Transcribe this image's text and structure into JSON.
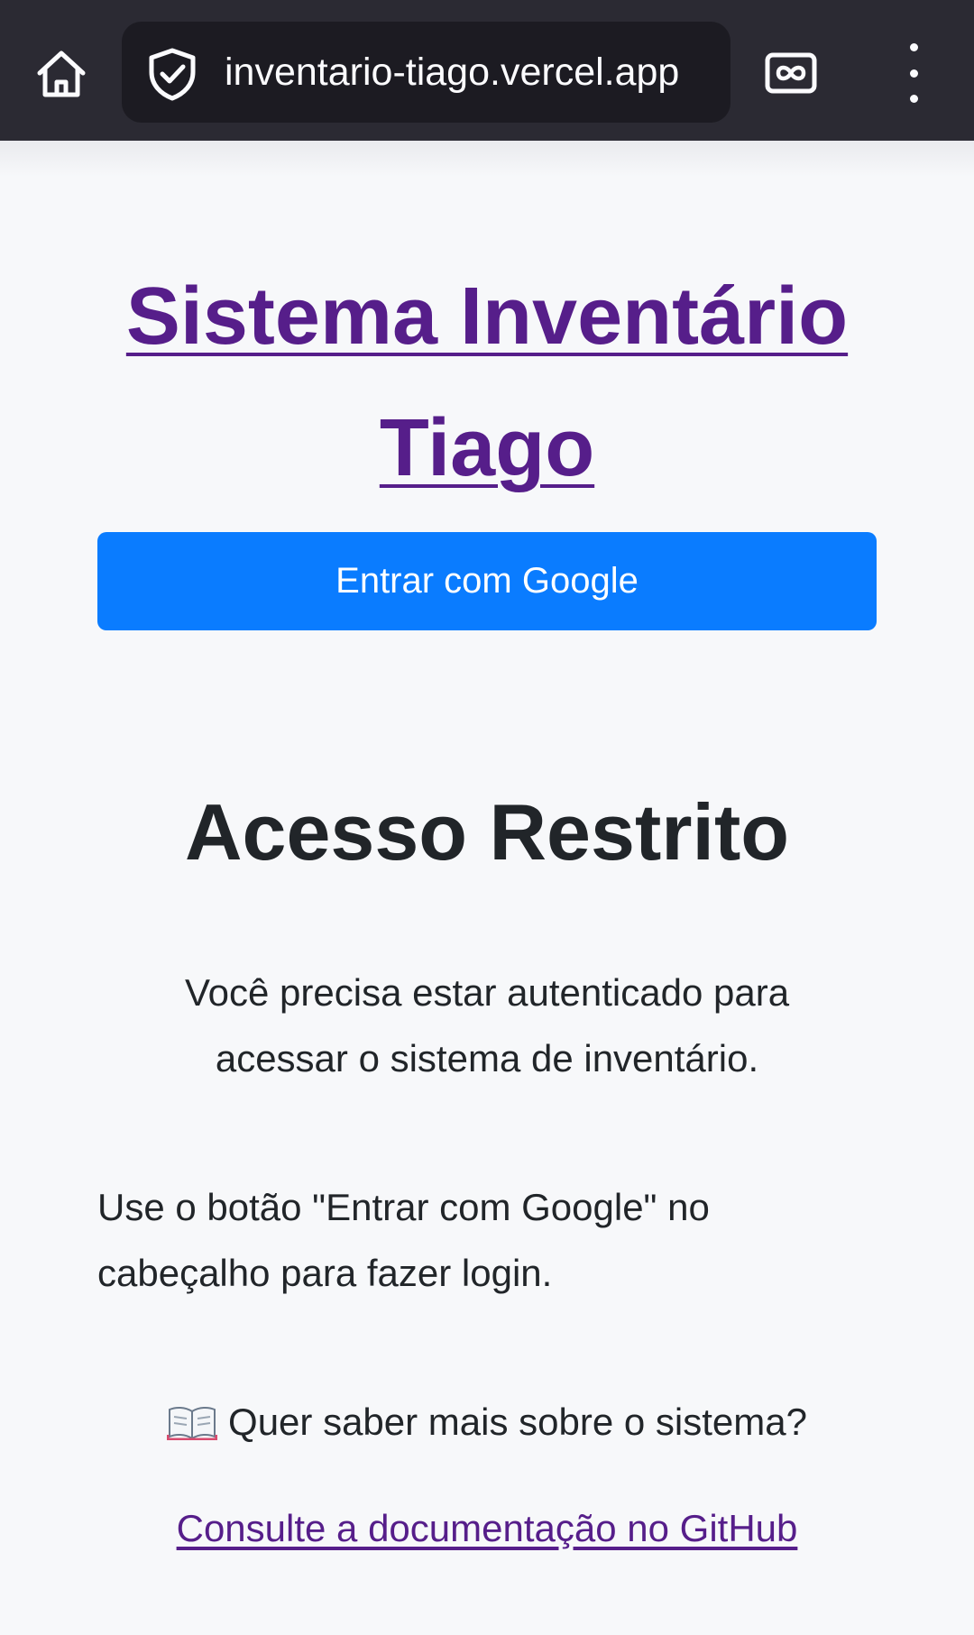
{
  "browser": {
    "url": "inventario-tiago.vercel.app",
    "home_icon": "home-icon",
    "security_icon": "shield-check-icon",
    "reader_icon": "reader-mode-icon",
    "menu_icon": "more-vertical-icon",
    "bar_color": "#2b2a33"
  },
  "header": {
    "title_line1": "Sistema Inventário",
    "title_line2": "Tiago",
    "title_color": "#561e8a",
    "login_button_label": "Entrar com Google",
    "login_button_color": "#0a7cff"
  },
  "main": {
    "heading": "Acesso Restrito",
    "auth_message": "Você precisa estar autenticado para acessar o sistema de inventário.",
    "instruction": "Use o botão \"Entrar com Google\" no cabeçalho para fazer login.",
    "docs_prompt": "Quer saber mais sobre o sistema?",
    "docs_icon": "open-book-icon",
    "docs_link_label": "Consulte a documentação no GitHub"
  }
}
